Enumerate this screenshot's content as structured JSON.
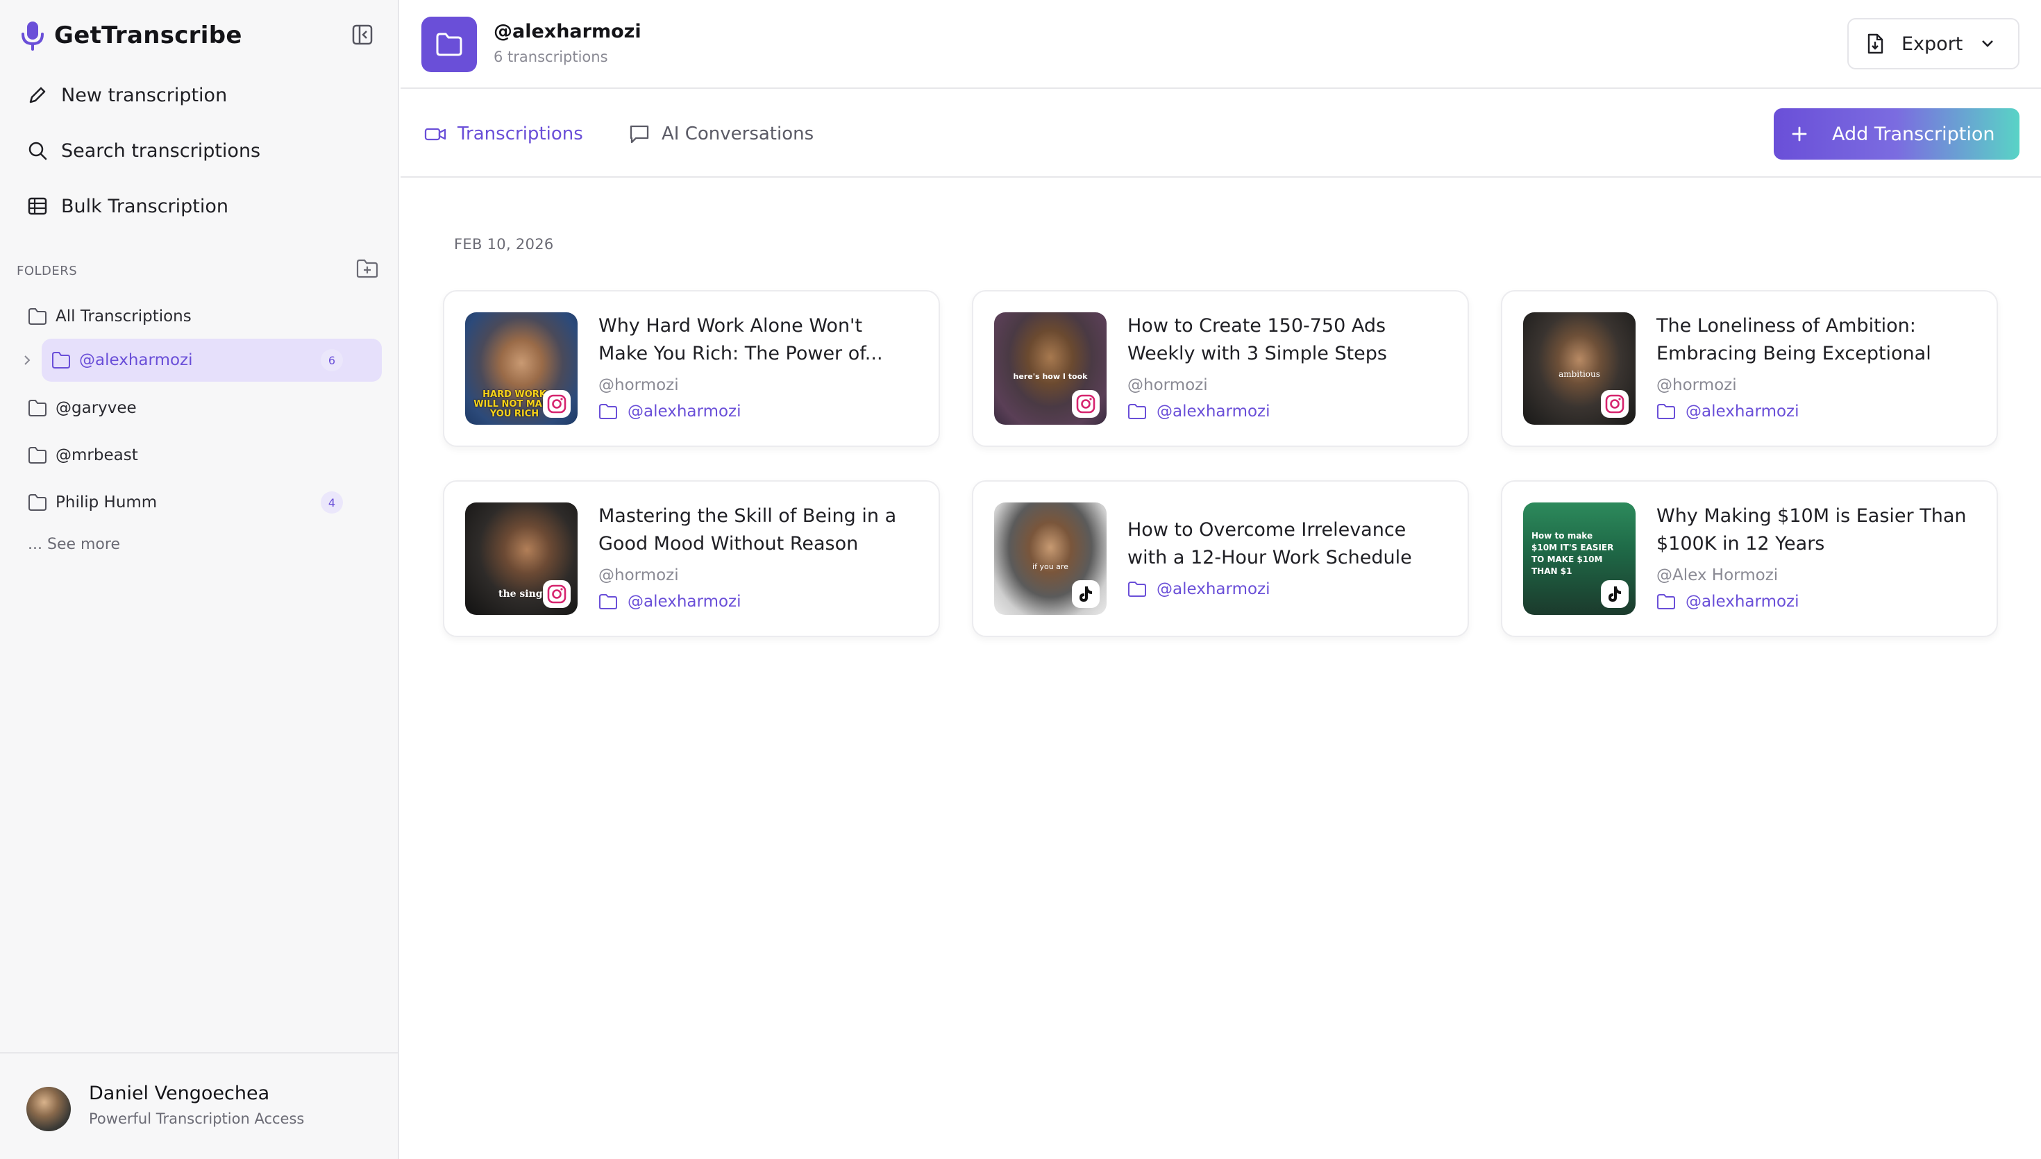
{
  "brand": {
    "name": "GetTranscribe"
  },
  "nav": {
    "new": "New transcription",
    "search": "Search transcriptions",
    "bulk": "Bulk Transcription"
  },
  "folders": {
    "heading": "FOLDERS",
    "items": [
      {
        "label": "All Transcriptions",
        "count": null
      },
      {
        "label": "@alexharmozi",
        "count": "6"
      },
      {
        "label": "@garyvee",
        "count": null
      },
      {
        "label": "@mrbeast",
        "count": null
      },
      {
        "label": "Philip Humm",
        "count": "4"
      }
    ],
    "see_more": "... See more"
  },
  "user": {
    "name": "Daniel Vengoechea",
    "plan": "Powerful Transcription Access"
  },
  "header": {
    "title": "@alexharmozi",
    "subtitle": "6 transcriptions",
    "export_label": "Export"
  },
  "tabs": [
    {
      "label": "Transcriptions",
      "active": true
    },
    {
      "label": "AI Conversations",
      "active": false
    }
  ],
  "add_button": "Add Transcription",
  "date_group": "FEB 10, 2026",
  "cards": [
    {
      "title_1": "Why Hard Work Alone Won't",
      "title_2": "Make You Rich: The Power of...",
      "author": "@hormozi",
      "folder": "@alexharmozi",
      "platform": "instagram",
      "thumb_text": "HARD WORK WILL NOT MAKE YOU RICH"
    },
    {
      "title_1": "How to Create 150-750 Ads",
      "title_2": "Weekly with 3 Simple Steps",
      "author": "@hormozi",
      "folder": "@alexharmozi",
      "platform": "instagram",
      "thumb_text": "here's how I took"
    },
    {
      "title_1": "The Loneliness of Ambition:",
      "title_2": "Embracing Being Exceptional",
      "author": "@hormozi",
      "folder": "@alexharmozi",
      "platform": "instagram",
      "thumb_text": "ambitious"
    },
    {
      "title_1": "Mastering the Skill of Being in a",
      "title_2": "Good Mood Without Reason",
      "author": "@hormozi",
      "folder": "@alexharmozi",
      "platform": "instagram",
      "thumb_text": "the single"
    },
    {
      "title_1": "How to Overcome Irrelevance",
      "title_2": "with a 12-Hour Work Schedule",
      "author": null,
      "folder": "@alexharmozi",
      "platform": "tiktok",
      "thumb_text": "if you are"
    },
    {
      "title_1": "Why Making $10M is Easier Than",
      "title_2": "$100K in 12 Years",
      "author": "@Alex Hormozi",
      "folder": "@alexharmozi",
      "platform": "tiktok",
      "thumb_text": "How to make $10M IT'S EASIER TO MAKE $10M THAN $1"
    }
  ],
  "colors": {
    "accent": "#6a4fd8",
    "accent_light": "#e6e0fb",
    "gradient_end": "#59d3c6"
  }
}
